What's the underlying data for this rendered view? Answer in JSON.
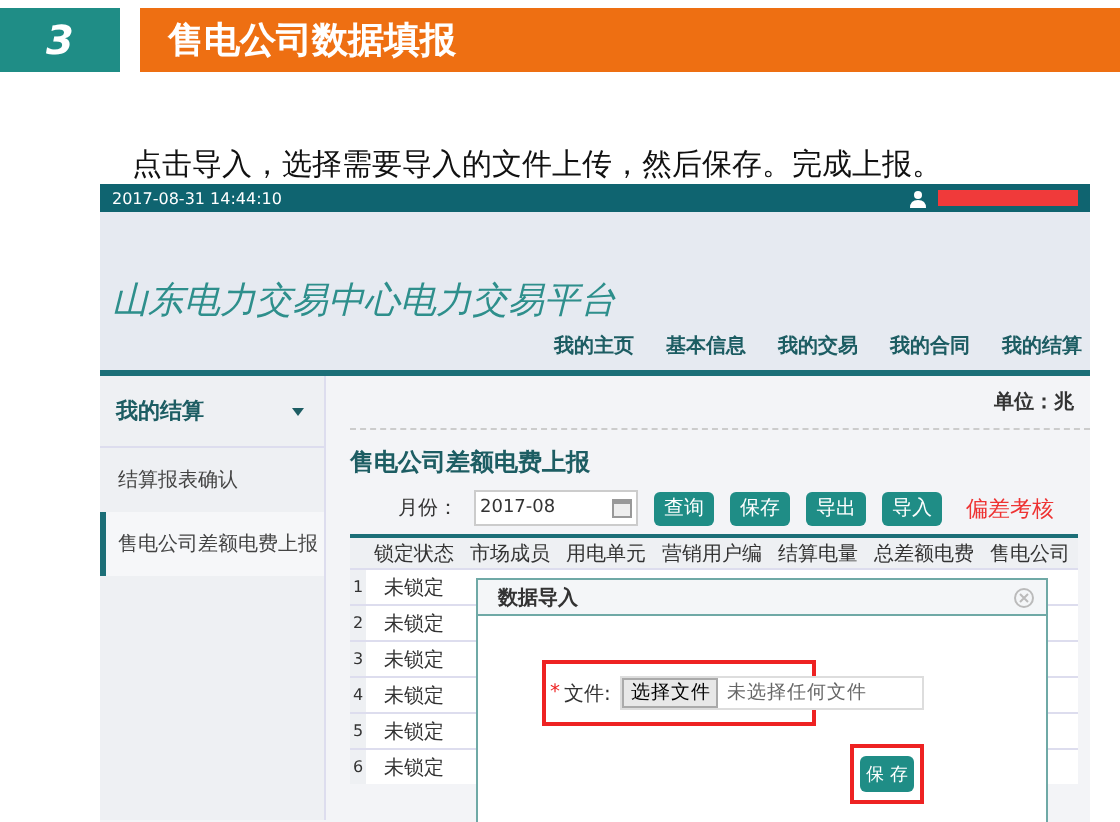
{
  "slide": {
    "number": "3",
    "title": "售电公司数据填报",
    "instruction": "点击导入，选择需要导入的文件上传，然后保存。完成上报。"
  },
  "app": {
    "timestamp": "2017-08-31 14:44:10",
    "platform_title": "山东电力交易中心电力交易平台",
    "nav": [
      "我的主页",
      "基本信息",
      "我的交易",
      "我的合同",
      "我的结算"
    ],
    "sidebar": {
      "header": "我的结算",
      "items": [
        {
          "label": "结算报表确认",
          "selected": false
        },
        {
          "label": "售电公司差额电费上报",
          "selected": true
        }
      ]
    },
    "unit": "单位：兆",
    "page_title": "售电公司差额电费上报",
    "filter": {
      "label": "月份：",
      "value": "2017-08"
    },
    "buttons": [
      "查询",
      "保存",
      "导出",
      "导入"
    ],
    "warning": "偏差考核",
    "table": {
      "columns": [
        "锁定状态",
        "市场成员",
        "用电单元",
        "营销用户编",
        "结算电量",
        "总差额电费",
        "售电公司"
      ],
      "rows": [
        {
          "index": "1",
          "lock_status": "未锁定"
        },
        {
          "index": "2",
          "lock_status": "未锁定"
        },
        {
          "index": "3",
          "lock_status": "未锁定"
        },
        {
          "index": "4",
          "lock_status": "未锁定"
        },
        {
          "index": "5",
          "lock_status": "未锁定"
        },
        {
          "index": "6",
          "lock_status": "未锁定"
        }
      ]
    },
    "dialog": {
      "title": "数据导入",
      "required_mark": "*",
      "field_label": "文件:",
      "file_button": "选择文件",
      "file_status": "未选择任何文件",
      "save_button": "保 存"
    }
  }
}
